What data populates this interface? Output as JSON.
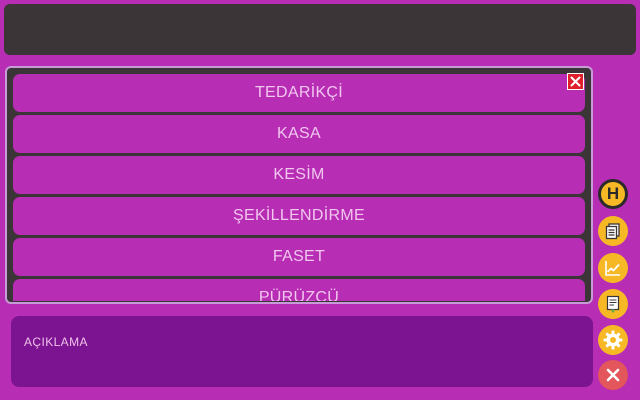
{
  "menu": {
    "items": [
      {
        "label": "TEDARİKÇİ"
      },
      {
        "label": "KASA"
      },
      {
        "label": "KESİM"
      },
      {
        "label": "ŞEKİLLENDİRME"
      },
      {
        "label": "FASET"
      },
      {
        "label": "PÜRÜZCÜ"
      }
    ]
  },
  "description": {
    "label": "AÇIKLAMA"
  },
  "side_buttons": {
    "h_label": "H",
    "icons": [
      "h-icon",
      "document-icon",
      "chart-icon",
      "report-icon",
      "gear-icon",
      "close-icon"
    ]
  },
  "colors": {
    "background": "#b72db4",
    "panel": "#3b3538",
    "description_box": "#7c1390",
    "accent_orange": "#f6b825",
    "close_red": "#e01e2c"
  }
}
